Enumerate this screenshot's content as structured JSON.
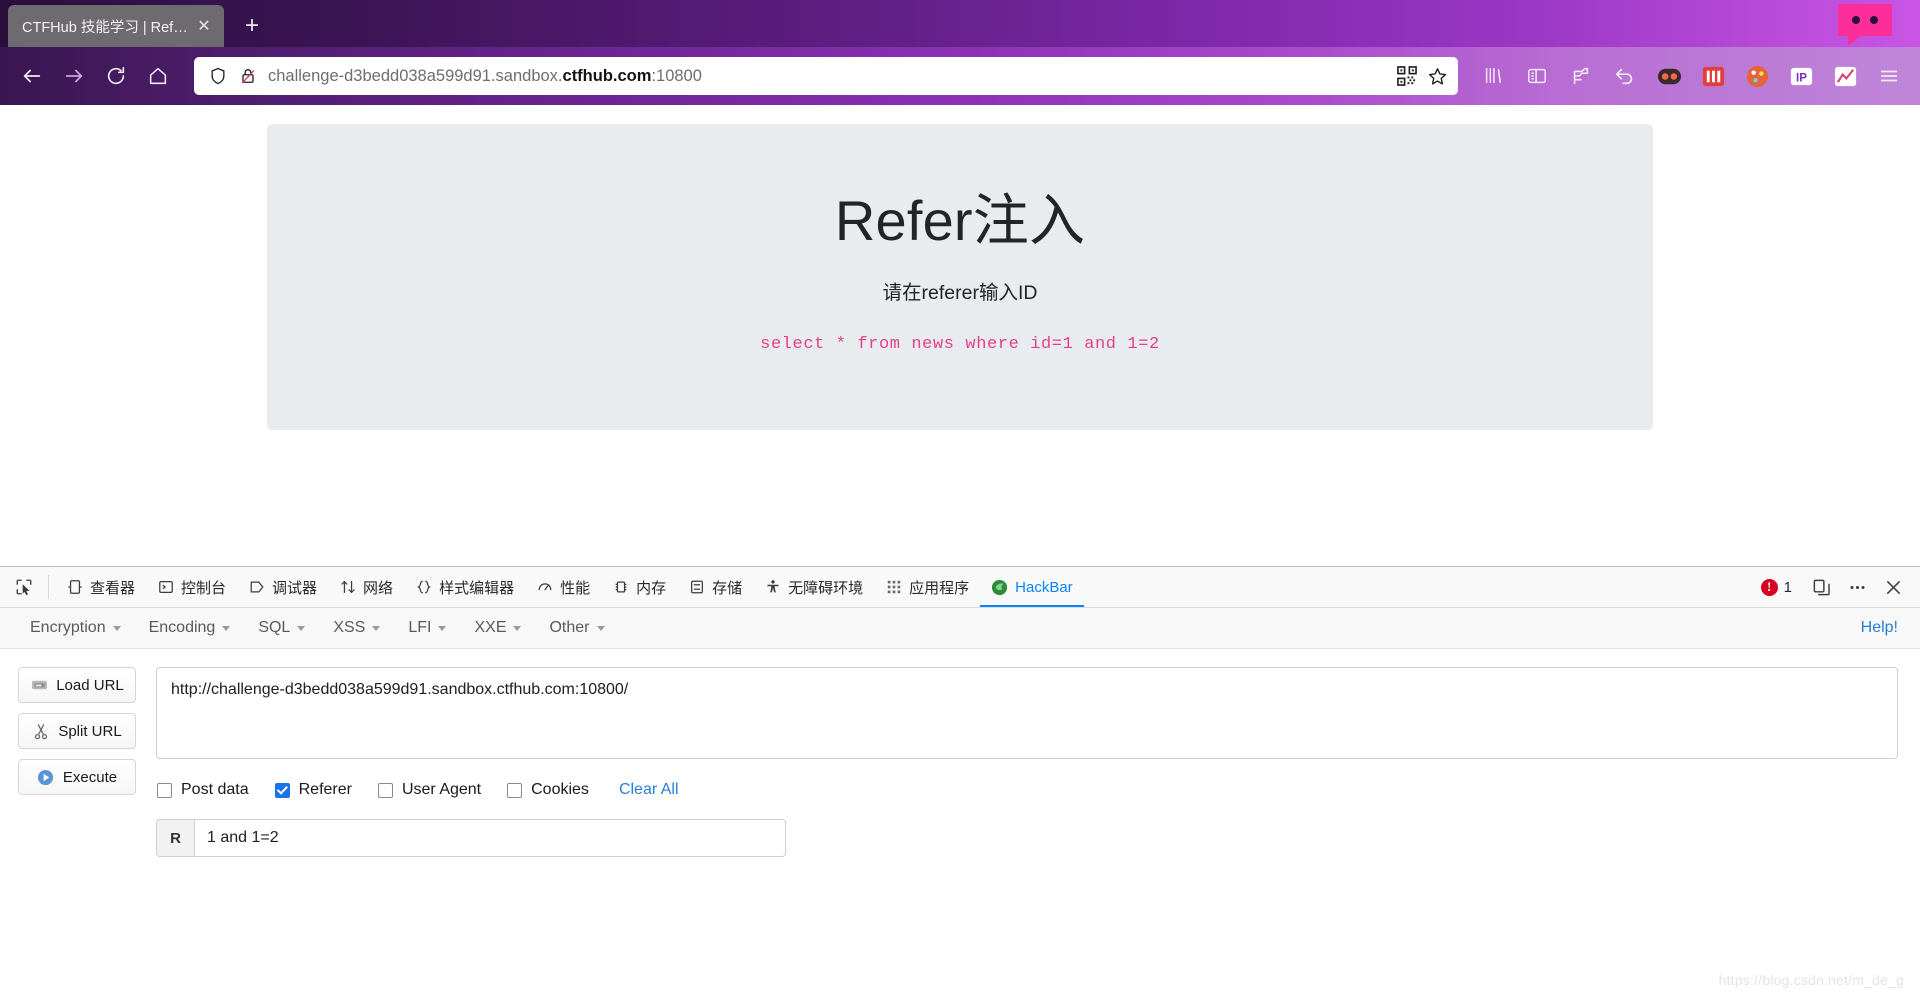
{
  "browser": {
    "tab": {
      "title": "CTFHub 技能学习 | Refer注入",
      "close_label": "✕"
    },
    "new_tab_label": "+",
    "nav": {
      "back_label": "←",
      "forward_label": "→",
      "reload_label": "⟳",
      "home_label": "⌂"
    },
    "url": {
      "prefix": "challenge-d3bedd038a599d91.sandbox.",
      "host": "ctfhub.com",
      "port": ":10800",
      "full": "challenge-d3bedd038a599d91.sandbox.ctfhub.com:10800",
      "shield_icon": "shield-icon",
      "lock_broken_icon": "lock-broken-icon",
      "qr_icon": "qr-code-icon",
      "bookmark_icon": "star-icon"
    },
    "toolbar_icons": [
      "library-icon",
      "sidebar-icon",
      "container-tab-icon",
      "undo-icon",
      "extension-dark-icon",
      "extension-red-icon",
      "extension-palette-icon",
      "extension-ip-icon",
      "extension-chart-icon",
      "menu-hamburger-icon"
    ]
  },
  "page": {
    "title": "Refer注入",
    "subtitle": "请在referer输入ID",
    "sql": "select * from news where id=1 and 1=2",
    "sql_color": "#e83e8c",
    "jumbotron_bg": "#e9ecef"
  },
  "devtools": {
    "picker_icon": "element-picker-icon",
    "responsive_icon": "responsive-design-icon",
    "tabs": [
      {
        "label": "查看器",
        "icon": "inspector-icon",
        "active": false
      },
      {
        "label": "控制台",
        "icon": "console-icon",
        "active": false
      },
      {
        "label": "调试器",
        "icon": "debugger-icon",
        "active": false
      },
      {
        "label": "网络",
        "icon": "network-icon",
        "active": false
      },
      {
        "label": "样式编辑器",
        "icon": "style-editor-icon",
        "active": false
      },
      {
        "label": "性能",
        "icon": "performance-icon",
        "active": false
      },
      {
        "label": "内存",
        "icon": "memory-icon",
        "active": false
      },
      {
        "label": "存储",
        "icon": "storage-icon",
        "active": false
      },
      {
        "label": "无障碍环境",
        "icon": "accessibility-icon",
        "active": false
      },
      {
        "label": "应用程序",
        "icon": "application-icon",
        "active": false
      },
      {
        "label": "HackBar",
        "icon": "hackbar-logo-icon",
        "active": true
      }
    ],
    "error_count": "1",
    "error_color": "#d70022",
    "active_tab_color": "#0a84ff",
    "dock_icon": "dock-layout-icon",
    "more_icon": "more-options-icon",
    "close_icon": "close-devtools-icon"
  },
  "hackbar": {
    "menus": [
      {
        "label": "Encryption"
      },
      {
        "label": "Encoding"
      },
      {
        "label": "SQL"
      },
      {
        "label": "XSS"
      },
      {
        "label": "LFI"
      },
      {
        "label": "XXE"
      },
      {
        "label": "Other"
      }
    ],
    "help_label": "Help!",
    "buttons": [
      {
        "label": "Load URL",
        "icon": "load-url-icon"
      },
      {
        "label": "Split URL",
        "icon": "split-url-scissors-icon"
      },
      {
        "label": "Execute",
        "icon": "execute-play-icon"
      }
    ],
    "url_value": "http://challenge-d3bedd038a599d91.sandbox.ctfhub.com:10800/",
    "url_placeholder": "",
    "checkboxes": [
      {
        "label": "Post data",
        "checked": false
      },
      {
        "label": "Referer",
        "checked": true
      },
      {
        "label": "User Agent",
        "checked": false
      },
      {
        "label": "Cookies",
        "checked": false
      }
    ],
    "clear_all_label": "Clear All",
    "referer_prefix": "R",
    "referer_value": "1 and 1=2",
    "referer_placeholder": ""
  },
  "watermark": "https://blog.csdn.net/m_de_g"
}
